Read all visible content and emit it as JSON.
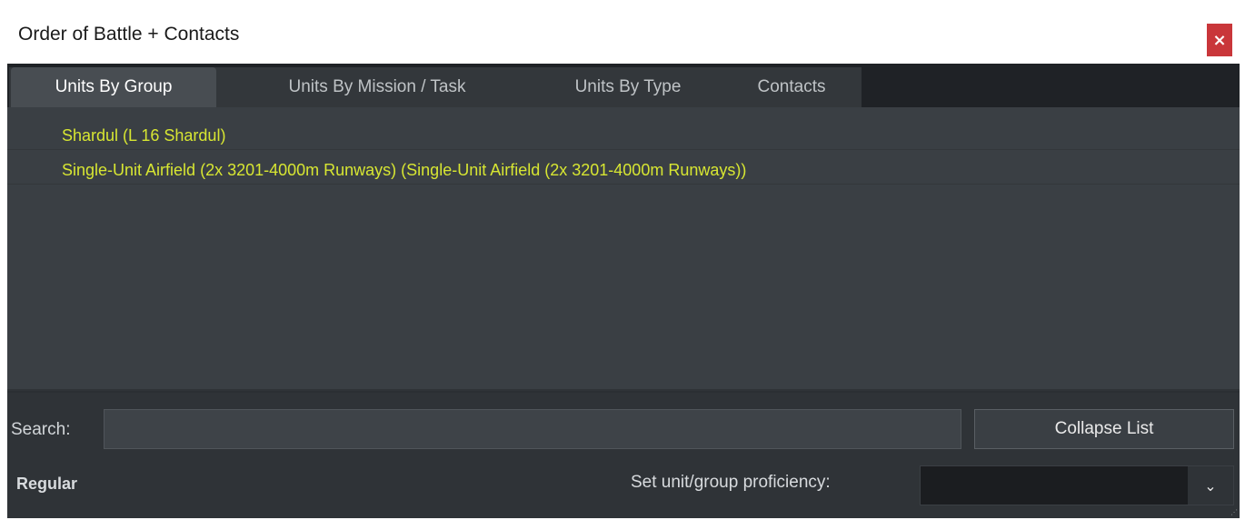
{
  "window": {
    "title": "Order of Battle + Contacts",
    "close_glyph": "×"
  },
  "tabs": [
    {
      "label": "Units By Group",
      "active": true
    },
    {
      "label": "Units By Mission / Task",
      "active": false
    },
    {
      "label": "Units By Type",
      "active": false
    },
    {
      "label": "Contacts",
      "active": false
    }
  ],
  "list": {
    "items": [
      "Shardul (L 16 Shardul)",
      "Single-Unit Airfield (2x 3201-4000m Runways) (Single-Unit Airfield (2x 3201-4000m Runways))"
    ],
    "item_color": "#d7e632"
  },
  "scrollbar": {
    "left_arrow": "‹",
    "right_arrow": "›"
  },
  "search": {
    "label": "Search:",
    "value": "",
    "placeholder": ""
  },
  "collapse_button": {
    "label": "Collapse List"
  },
  "proficiency": {
    "current": "Regular",
    "set_label": "Set unit/group proficiency:",
    "selected": "",
    "chevron": "⌄"
  },
  "colors": {
    "accent_close": "#c9363a",
    "panel_bg": "#2f3337",
    "list_text": "#d7e632"
  }
}
